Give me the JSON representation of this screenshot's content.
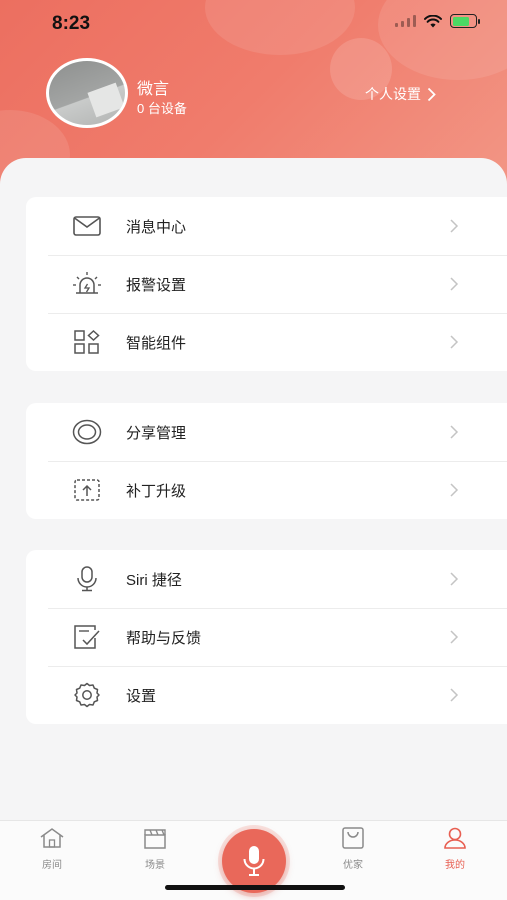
{
  "status_bar": {
    "time": "8:23"
  },
  "profile": {
    "username": "微言",
    "device_count": "0 台设备",
    "personal_settings_label": "个人设置"
  },
  "groups": [
    {
      "items": [
        {
          "label": "消息中心",
          "icon": "mail-icon"
        },
        {
          "label": "报警设置",
          "icon": "alarm-icon"
        },
        {
          "label": "智能组件",
          "icon": "widgets-icon"
        }
      ]
    },
    {
      "items": [
        {
          "label": "分享管理",
          "icon": "share-ring-icon"
        },
        {
          "label": "补丁升级",
          "icon": "upgrade-icon"
        }
      ]
    },
    {
      "items": [
        {
          "label": "Siri 捷径",
          "icon": "microphone-icon"
        },
        {
          "label": "帮助与反馈",
          "icon": "feedback-icon"
        },
        {
          "label": "设置",
          "icon": "gear-icon"
        }
      ]
    }
  ],
  "tabbar": {
    "tabs": [
      {
        "label": "房间",
        "icon": "house-icon"
      },
      {
        "label": "场景",
        "icon": "clapperboard-icon"
      },
      {
        "label": "优家",
        "icon": "shopping-bag-icon"
      },
      {
        "label": "我的",
        "icon": "person-icon",
        "active": true
      }
    ],
    "center": "microphone-icon"
  },
  "colors": {
    "accent": "#e9685a",
    "header": "#ef7565"
  }
}
